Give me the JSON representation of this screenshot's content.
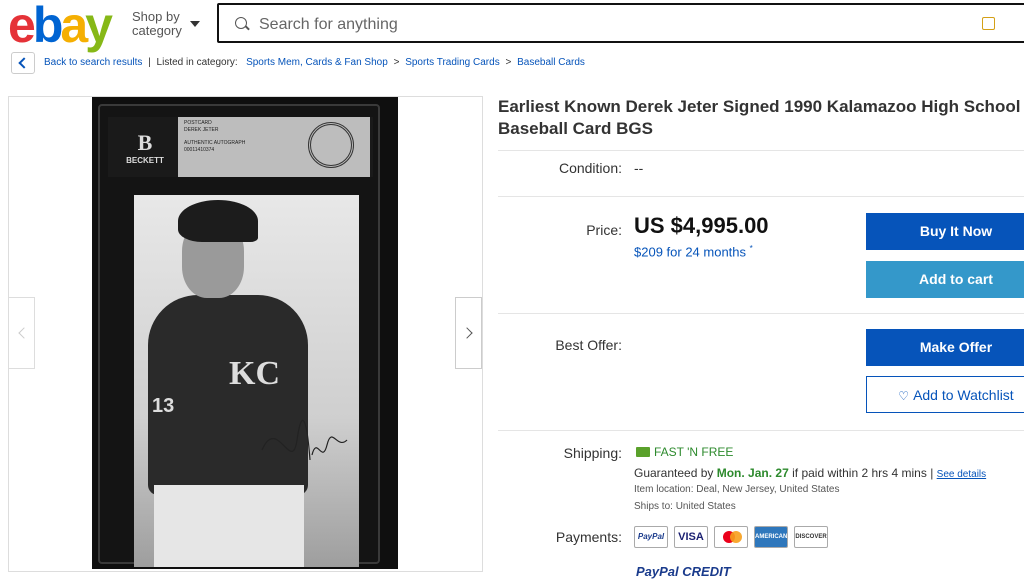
{
  "header": {
    "logo_letters": [
      "e",
      "b",
      "a",
      "y"
    ],
    "shop_by_line1": "Shop by",
    "shop_by_line2": "category",
    "search_placeholder": "Search for anything"
  },
  "breadcrumb": {
    "back_label": "Back to search results",
    "listed_in": "Listed in category:",
    "categories": [
      "Sports Mem, Cards & Fan Shop",
      "Sports Trading Cards",
      "Baseball Cards"
    ],
    "separator": ">"
  },
  "gallery": {
    "slab_brand": "BECKETT",
    "slab_lines": [
      "POSTCARD",
      "DEREK JETER",
      "AUTHENTIC AUTOGRAPH",
      "00011410374"
    ],
    "uniform_logo": "KC",
    "uniform_number": "13"
  },
  "listing": {
    "title": "Earliest Known Derek Jeter Signed 1990 Kalamazoo High School Baseball Card BGS",
    "condition_label": "Condition:",
    "condition_value": "--",
    "price_label": "Price:",
    "price": "US $4,995.00",
    "monthly": "$209 for 24 months",
    "monthly_mark": "*",
    "buy_now": "Buy It Now",
    "add_to_cart": "Add to cart",
    "best_offer_label": "Best Offer:",
    "make_offer": "Make Offer",
    "watchlist": "Add to Watchlist",
    "shipping_label": "Shipping:",
    "shipping_badge": "FAST 'N FREE",
    "guaranteed_prefix": "Guaranteed by",
    "guaranteed_date": "Mon. Jan. 27",
    "guaranteed_suffix": "if paid within 2 hrs 4 mins",
    "guaranteed_sep": "|",
    "see_details": "See details",
    "item_location": "Item location: Deal, New Jersey, United States",
    "ships_to": "Ships to: United States",
    "payments_label": "Payments:",
    "payment_methods": [
      "PayPal",
      "VISA",
      "",
      "AMERICAN EXPRESS",
      "DISCOVER"
    ],
    "paypal_credit": "PayPal CREDIT"
  },
  "colors": {
    "primary_blue": "#0654ba",
    "cart_blue": "#3498ca",
    "free_green": "#2d8a2d"
  }
}
